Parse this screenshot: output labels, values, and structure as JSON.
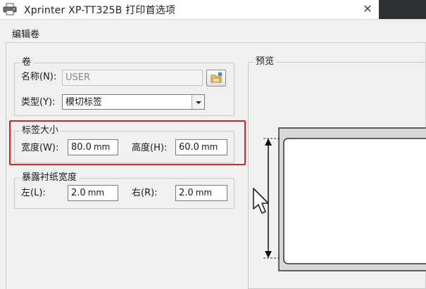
{
  "window": {
    "title": "Xprinter XP-TT325B 打印首选项",
    "close_label": "✕",
    "app_icon": "printer-icon"
  },
  "tabs": [
    {
      "label": "编辑卷",
      "selected": true
    }
  ],
  "roll_group": {
    "caption": "卷",
    "name_label": "名称(N):",
    "name_value": "USER",
    "browse_icon": "folder-browse-icon",
    "type_label": "类型(Y):",
    "type_value": "模切标签"
  },
  "label_size": {
    "caption": "标签大小",
    "width_label": "宽度(W):",
    "width_value": "80.0",
    "width_unit": "mm",
    "height_label": "高度(H):",
    "height_value": "60.0",
    "height_unit": "mm",
    "highlight_color": "#e02020"
  },
  "liner_group": {
    "caption": "暴露衬纸宽度",
    "left_label": "左(L):",
    "left_value": "2.0",
    "left_unit": "mm",
    "right_label": "右(R):",
    "right_value": "2.0",
    "right_unit": "mm"
  },
  "preview": {
    "caption": "预览"
  }
}
